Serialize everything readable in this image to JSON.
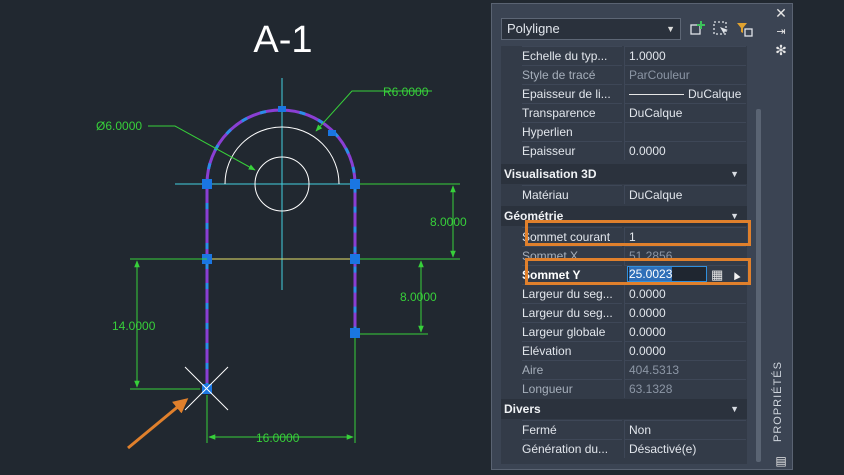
{
  "drawing": {
    "title": "A-1",
    "dimensions": {
      "radius": "R6.0000",
      "diameter": "Ø6.0000",
      "dim_right_upper": "8.0000",
      "dim_right_lower": "8.0000",
      "dim_left": "14.0000",
      "dim_bottom": "16.0000"
    },
    "colors": {
      "background": "#212830",
      "dimension": "#37d03a",
      "polyline": "#8a3fd4",
      "grip": "#1a76e2",
      "centerline": "#42d0e0",
      "arrow": "#e0802c"
    }
  },
  "palette": {
    "object_type": "Polyligne",
    "toolbar_icons": [
      "toggle-pickadd-icon",
      "select-objects-icon",
      "quick-select-icon"
    ],
    "general_rows": [
      {
        "name": "Echelle du typ...",
        "value": "1.0000"
      },
      {
        "name": "Style de tracé",
        "value": "ParCouleur",
        "dim": true
      },
      {
        "name": "Epaisseur de li...",
        "value": "DuCalque",
        "lineweight": true
      },
      {
        "name": "Transparence",
        "value": "DuCalque"
      },
      {
        "name": "Hyperlien",
        "value": ""
      },
      {
        "name": "Epaisseur",
        "value": "0.0000"
      }
    ],
    "sections": {
      "viz3d": "Visualisation 3D",
      "geometry": "Géométrie",
      "misc": "Divers"
    },
    "viz3d_rows": [
      {
        "name": "Matériau",
        "value": "DuCalque"
      }
    ],
    "geometry_rows": [
      {
        "name": "Sommet courant",
        "value": "1"
      },
      {
        "name": "Sommet X",
        "value": "51.2856",
        "dim": true
      },
      {
        "name": "Sommet Y",
        "value": "25.0023",
        "editing": true
      },
      {
        "name": "Largeur du seg...",
        "value": "0.0000"
      },
      {
        "name": "Largeur du seg...",
        "value": "0.0000"
      },
      {
        "name": "Largeur globale",
        "value": "0.0000"
      },
      {
        "name": "Elévation",
        "value": "0.0000"
      },
      {
        "name": "Aire",
        "value": "404.5313",
        "dim": true
      },
      {
        "name": "Longueur",
        "value": "63.1328",
        "dim": true
      }
    ],
    "misc_rows": [
      {
        "name": "Fermé",
        "value": "Non"
      },
      {
        "name": "Génération du...",
        "value": "Désactivé(e)"
      }
    ],
    "side_label": "PROPRIÉTÉS",
    "side_icons": [
      "close-icon",
      "auto-hide-icon",
      "properties-menu-icon"
    ]
  }
}
